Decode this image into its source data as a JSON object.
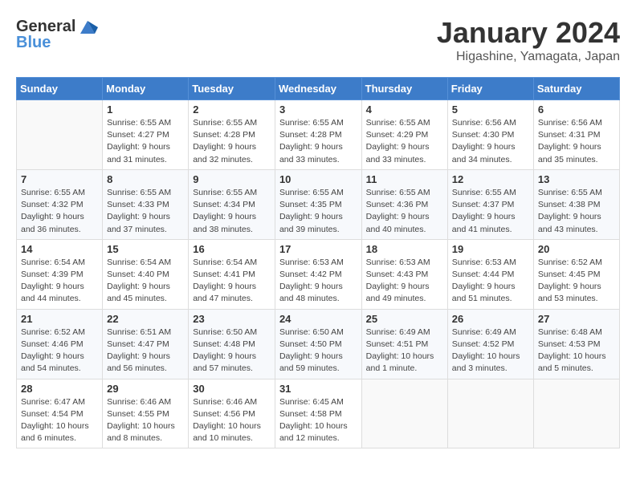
{
  "header": {
    "logo_general": "General",
    "logo_blue": "Blue",
    "month_year": "January 2024",
    "location": "Higashine, Yamagata, Japan"
  },
  "weekdays": [
    "Sunday",
    "Monday",
    "Tuesday",
    "Wednesday",
    "Thursday",
    "Friday",
    "Saturday"
  ],
  "weeks": [
    [
      {
        "day": "",
        "sunrise": "",
        "sunset": "",
        "daylight": ""
      },
      {
        "day": "1",
        "sunrise": "Sunrise: 6:55 AM",
        "sunset": "Sunset: 4:27 PM",
        "daylight": "Daylight: 9 hours and 31 minutes."
      },
      {
        "day": "2",
        "sunrise": "Sunrise: 6:55 AM",
        "sunset": "Sunset: 4:28 PM",
        "daylight": "Daylight: 9 hours and 32 minutes."
      },
      {
        "day": "3",
        "sunrise": "Sunrise: 6:55 AM",
        "sunset": "Sunset: 4:28 PM",
        "daylight": "Daylight: 9 hours and 33 minutes."
      },
      {
        "day": "4",
        "sunrise": "Sunrise: 6:55 AM",
        "sunset": "Sunset: 4:29 PM",
        "daylight": "Daylight: 9 hours and 33 minutes."
      },
      {
        "day": "5",
        "sunrise": "Sunrise: 6:56 AM",
        "sunset": "Sunset: 4:30 PM",
        "daylight": "Daylight: 9 hours and 34 minutes."
      },
      {
        "day": "6",
        "sunrise": "Sunrise: 6:56 AM",
        "sunset": "Sunset: 4:31 PM",
        "daylight": "Daylight: 9 hours and 35 minutes."
      }
    ],
    [
      {
        "day": "7",
        "sunrise": "Sunrise: 6:55 AM",
        "sunset": "Sunset: 4:32 PM",
        "daylight": "Daylight: 9 hours and 36 minutes."
      },
      {
        "day": "8",
        "sunrise": "Sunrise: 6:55 AM",
        "sunset": "Sunset: 4:33 PM",
        "daylight": "Daylight: 9 hours and 37 minutes."
      },
      {
        "day": "9",
        "sunrise": "Sunrise: 6:55 AM",
        "sunset": "Sunset: 4:34 PM",
        "daylight": "Daylight: 9 hours and 38 minutes."
      },
      {
        "day": "10",
        "sunrise": "Sunrise: 6:55 AM",
        "sunset": "Sunset: 4:35 PM",
        "daylight": "Daylight: 9 hours and 39 minutes."
      },
      {
        "day": "11",
        "sunrise": "Sunrise: 6:55 AM",
        "sunset": "Sunset: 4:36 PM",
        "daylight": "Daylight: 9 hours and 40 minutes."
      },
      {
        "day": "12",
        "sunrise": "Sunrise: 6:55 AM",
        "sunset": "Sunset: 4:37 PM",
        "daylight": "Daylight: 9 hours and 41 minutes."
      },
      {
        "day": "13",
        "sunrise": "Sunrise: 6:55 AM",
        "sunset": "Sunset: 4:38 PM",
        "daylight": "Daylight: 9 hours and 43 minutes."
      }
    ],
    [
      {
        "day": "14",
        "sunrise": "Sunrise: 6:54 AM",
        "sunset": "Sunset: 4:39 PM",
        "daylight": "Daylight: 9 hours and 44 minutes."
      },
      {
        "day": "15",
        "sunrise": "Sunrise: 6:54 AM",
        "sunset": "Sunset: 4:40 PM",
        "daylight": "Daylight: 9 hours and 45 minutes."
      },
      {
        "day": "16",
        "sunrise": "Sunrise: 6:54 AM",
        "sunset": "Sunset: 4:41 PM",
        "daylight": "Daylight: 9 hours and 47 minutes."
      },
      {
        "day": "17",
        "sunrise": "Sunrise: 6:53 AM",
        "sunset": "Sunset: 4:42 PM",
        "daylight": "Daylight: 9 hours and 48 minutes."
      },
      {
        "day": "18",
        "sunrise": "Sunrise: 6:53 AM",
        "sunset": "Sunset: 4:43 PM",
        "daylight": "Daylight: 9 hours and 49 minutes."
      },
      {
        "day": "19",
        "sunrise": "Sunrise: 6:53 AM",
        "sunset": "Sunset: 4:44 PM",
        "daylight": "Daylight: 9 hours and 51 minutes."
      },
      {
        "day": "20",
        "sunrise": "Sunrise: 6:52 AM",
        "sunset": "Sunset: 4:45 PM",
        "daylight": "Daylight: 9 hours and 53 minutes."
      }
    ],
    [
      {
        "day": "21",
        "sunrise": "Sunrise: 6:52 AM",
        "sunset": "Sunset: 4:46 PM",
        "daylight": "Daylight: 9 hours and 54 minutes."
      },
      {
        "day": "22",
        "sunrise": "Sunrise: 6:51 AM",
        "sunset": "Sunset: 4:47 PM",
        "daylight": "Daylight: 9 hours and 56 minutes."
      },
      {
        "day": "23",
        "sunrise": "Sunrise: 6:50 AM",
        "sunset": "Sunset: 4:48 PM",
        "daylight": "Daylight: 9 hours and 57 minutes."
      },
      {
        "day": "24",
        "sunrise": "Sunrise: 6:50 AM",
        "sunset": "Sunset: 4:50 PM",
        "daylight": "Daylight: 9 hours and 59 minutes."
      },
      {
        "day": "25",
        "sunrise": "Sunrise: 6:49 AM",
        "sunset": "Sunset: 4:51 PM",
        "daylight": "Daylight: 10 hours and 1 minute."
      },
      {
        "day": "26",
        "sunrise": "Sunrise: 6:49 AM",
        "sunset": "Sunset: 4:52 PM",
        "daylight": "Daylight: 10 hours and 3 minutes."
      },
      {
        "day": "27",
        "sunrise": "Sunrise: 6:48 AM",
        "sunset": "Sunset: 4:53 PM",
        "daylight": "Daylight: 10 hours and 5 minutes."
      }
    ],
    [
      {
        "day": "28",
        "sunrise": "Sunrise: 6:47 AM",
        "sunset": "Sunset: 4:54 PM",
        "daylight": "Daylight: 10 hours and 6 minutes."
      },
      {
        "day": "29",
        "sunrise": "Sunrise: 6:46 AM",
        "sunset": "Sunset: 4:55 PM",
        "daylight": "Daylight: 10 hours and 8 minutes."
      },
      {
        "day": "30",
        "sunrise": "Sunrise: 6:46 AM",
        "sunset": "Sunset: 4:56 PM",
        "daylight": "Daylight: 10 hours and 10 minutes."
      },
      {
        "day": "31",
        "sunrise": "Sunrise: 6:45 AM",
        "sunset": "Sunset: 4:58 PM",
        "daylight": "Daylight: 10 hours and 12 minutes."
      },
      {
        "day": "",
        "sunrise": "",
        "sunset": "",
        "daylight": ""
      },
      {
        "day": "",
        "sunrise": "",
        "sunset": "",
        "daylight": ""
      },
      {
        "day": "",
        "sunrise": "",
        "sunset": "",
        "daylight": ""
      }
    ]
  ]
}
